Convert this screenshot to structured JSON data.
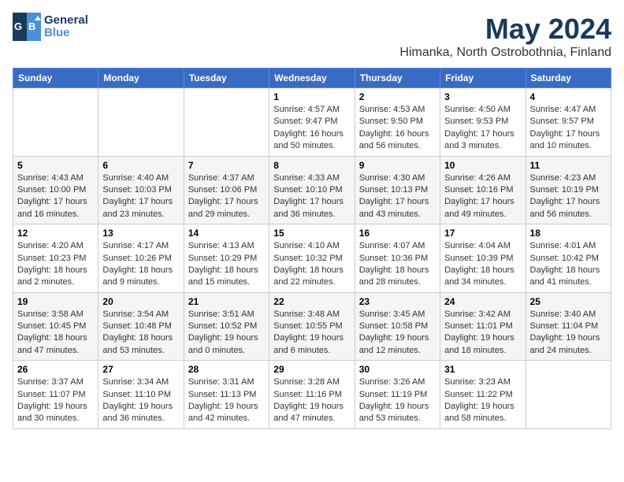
{
  "header": {
    "logo_line1": "General",
    "logo_line2": "Blue",
    "main_title": "May 2024",
    "subtitle": "Himanka, North Ostrobothnia, Finland"
  },
  "weekdays": [
    "Sunday",
    "Monday",
    "Tuesday",
    "Wednesday",
    "Thursday",
    "Friday",
    "Saturday"
  ],
  "weeks": [
    [
      {
        "day": "",
        "info": ""
      },
      {
        "day": "",
        "info": ""
      },
      {
        "day": "",
        "info": ""
      },
      {
        "day": "1",
        "info": "Sunrise: 4:57 AM\nSunset: 9:47 PM\nDaylight: 16 hours\nand 50 minutes."
      },
      {
        "day": "2",
        "info": "Sunrise: 4:53 AM\nSunset: 9:50 PM\nDaylight: 16 hours\nand 56 minutes."
      },
      {
        "day": "3",
        "info": "Sunrise: 4:50 AM\nSunset: 9:53 PM\nDaylight: 17 hours\nand 3 minutes."
      },
      {
        "day": "4",
        "info": "Sunrise: 4:47 AM\nSunset: 9:57 PM\nDaylight: 17 hours\nand 10 minutes."
      }
    ],
    [
      {
        "day": "5",
        "info": "Sunrise: 4:43 AM\nSunset: 10:00 PM\nDaylight: 17 hours\nand 16 minutes."
      },
      {
        "day": "6",
        "info": "Sunrise: 4:40 AM\nSunset: 10:03 PM\nDaylight: 17 hours\nand 23 minutes."
      },
      {
        "day": "7",
        "info": "Sunrise: 4:37 AM\nSunset: 10:06 PM\nDaylight: 17 hours\nand 29 minutes."
      },
      {
        "day": "8",
        "info": "Sunrise: 4:33 AM\nSunset: 10:10 PM\nDaylight: 17 hours\nand 36 minutes."
      },
      {
        "day": "9",
        "info": "Sunrise: 4:30 AM\nSunset: 10:13 PM\nDaylight: 17 hours\nand 43 minutes."
      },
      {
        "day": "10",
        "info": "Sunrise: 4:26 AM\nSunset: 10:16 PM\nDaylight: 17 hours\nand 49 minutes."
      },
      {
        "day": "11",
        "info": "Sunrise: 4:23 AM\nSunset: 10:19 PM\nDaylight: 17 hours\nand 56 minutes."
      }
    ],
    [
      {
        "day": "12",
        "info": "Sunrise: 4:20 AM\nSunset: 10:23 PM\nDaylight: 18 hours\nand 2 minutes."
      },
      {
        "day": "13",
        "info": "Sunrise: 4:17 AM\nSunset: 10:26 PM\nDaylight: 18 hours\nand 9 minutes."
      },
      {
        "day": "14",
        "info": "Sunrise: 4:13 AM\nSunset: 10:29 PM\nDaylight: 18 hours\nand 15 minutes."
      },
      {
        "day": "15",
        "info": "Sunrise: 4:10 AM\nSunset: 10:32 PM\nDaylight: 18 hours\nand 22 minutes."
      },
      {
        "day": "16",
        "info": "Sunrise: 4:07 AM\nSunset: 10:36 PM\nDaylight: 18 hours\nand 28 minutes."
      },
      {
        "day": "17",
        "info": "Sunrise: 4:04 AM\nSunset: 10:39 PM\nDaylight: 18 hours\nand 34 minutes."
      },
      {
        "day": "18",
        "info": "Sunrise: 4:01 AM\nSunset: 10:42 PM\nDaylight: 18 hours\nand 41 minutes."
      }
    ],
    [
      {
        "day": "19",
        "info": "Sunrise: 3:58 AM\nSunset: 10:45 PM\nDaylight: 18 hours\nand 47 minutes."
      },
      {
        "day": "20",
        "info": "Sunrise: 3:54 AM\nSunset: 10:48 PM\nDaylight: 18 hours\nand 53 minutes."
      },
      {
        "day": "21",
        "info": "Sunrise: 3:51 AM\nSunset: 10:52 PM\nDaylight: 19 hours\nand 0 minutes."
      },
      {
        "day": "22",
        "info": "Sunrise: 3:48 AM\nSunset: 10:55 PM\nDaylight: 19 hours\nand 6 minutes."
      },
      {
        "day": "23",
        "info": "Sunrise: 3:45 AM\nSunset: 10:58 PM\nDaylight: 19 hours\nand 12 minutes."
      },
      {
        "day": "24",
        "info": "Sunrise: 3:42 AM\nSunset: 11:01 PM\nDaylight: 19 hours\nand 18 minutes."
      },
      {
        "day": "25",
        "info": "Sunrise: 3:40 AM\nSunset: 11:04 PM\nDaylight: 19 hours\nand 24 minutes."
      }
    ],
    [
      {
        "day": "26",
        "info": "Sunrise: 3:37 AM\nSunset: 11:07 PM\nDaylight: 19 hours\nand 30 minutes."
      },
      {
        "day": "27",
        "info": "Sunrise: 3:34 AM\nSunset: 11:10 PM\nDaylight: 19 hours\nand 36 minutes."
      },
      {
        "day": "28",
        "info": "Sunrise: 3:31 AM\nSunset: 11:13 PM\nDaylight: 19 hours\nand 42 minutes."
      },
      {
        "day": "29",
        "info": "Sunrise: 3:28 AM\nSunset: 11:16 PM\nDaylight: 19 hours\nand 47 minutes."
      },
      {
        "day": "30",
        "info": "Sunrise: 3:26 AM\nSunset: 11:19 PM\nDaylight: 19 hours\nand 53 minutes."
      },
      {
        "day": "31",
        "info": "Sunrise: 3:23 AM\nSunset: 11:22 PM\nDaylight: 19 hours\nand 58 minutes."
      },
      {
        "day": "",
        "info": ""
      }
    ]
  ]
}
